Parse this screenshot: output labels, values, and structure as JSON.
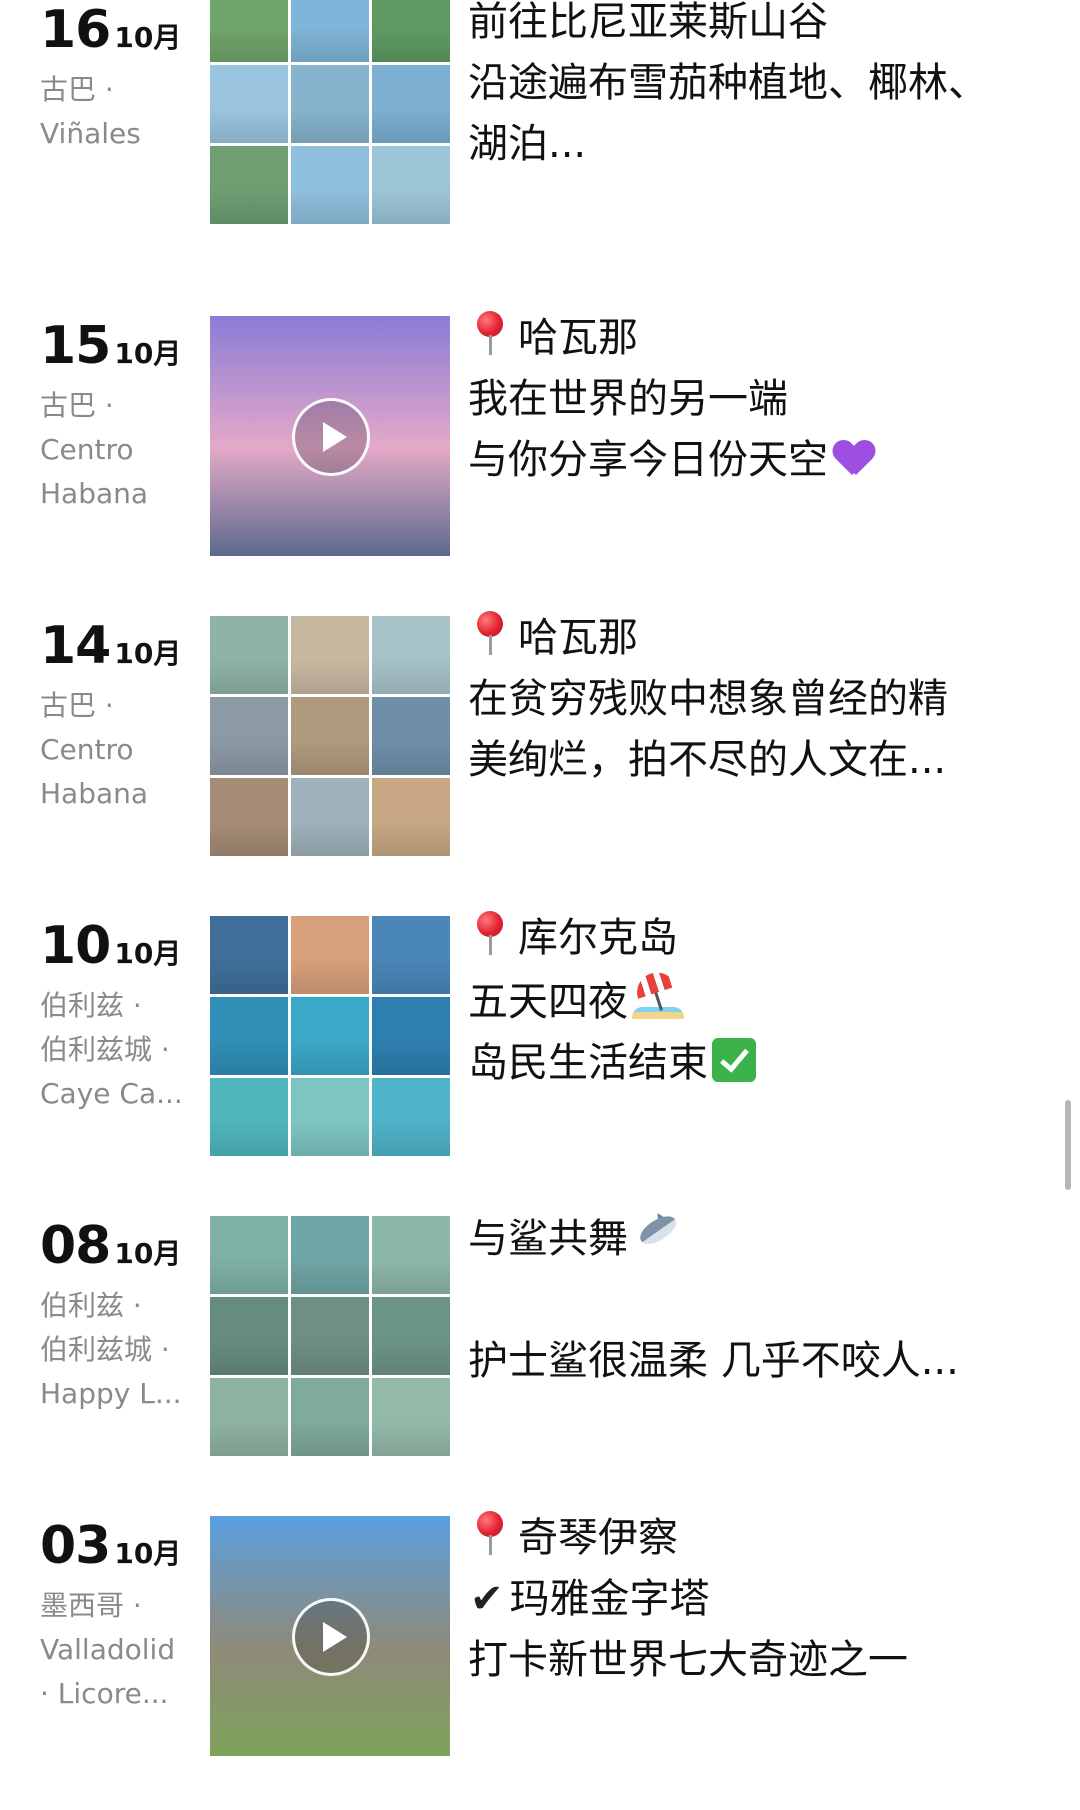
{
  "posts": [
    {
      "day": "16",
      "month": "10月",
      "location": [
        "古巴 ·",
        "Viñales"
      ],
      "media": "grid",
      "caption": [
        {
          "text": "前往比尼亚莱斯山谷"
        },
        {
          "text": "沿途遍布雪茄种植地、椰林、"
        },
        {
          "text": "湖泊..."
        }
      ],
      "colors": [
        "#6fa56a",
        "#7fb5d8",
        "#5f9a63",
        "#9ac4e0",
        "#86b4cc",
        "#7dafd3",
        "#6d9f73",
        "#8fc0de",
        "#9cc5d8"
      ]
    },
    {
      "day": "15",
      "month": "10月",
      "location": [
        "古巴 ·",
        "Centro",
        "Habana"
      ],
      "media": "video",
      "caption": [
        {
          "text": "哈瓦那",
          "pin": true
        },
        {
          "text": "我在世界的另一端"
        },
        {
          "text": "与你分享今日份天空",
          "emoji": "purple-heart"
        }
      ],
      "colors": [
        "#8b7bd8",
        "#e3a9c7",
        "#5c6a8e"
      ]
    },
    {
      "day": "14",
      "month": "10月",
      "location": [
        "古巴 ·",
        "Centro",
        "Habana"
      ],
      "media": "grid",
      "caption": [
        {
          "text": "哈瓦那",
          "pin": true
        },
        {
          "text": "在贫穷残败中想象曾经的精"
        },
        {
          "text": "美绚烂，拍不尽的人文在..."
        }
      ],
      "colors": [
        "#8fb3a8",
        "#c7b8a0",
        "#a7c3c8",
        "#8c9aa6",
        "#b09a7e",
        "#6f8fa8",
        "#a58c76",
        "#9fb1bb",
        "#c8a884"
      ]
    },
    {
      "day": "10",
      "month": "10月",
      "location": [
        "伯利兹 ·",
        "伯利兹城 ·",
        "Caye Ca..."
      ],
      "media": "grid",
      "caption": [
        {
          "text": "库尔克岛",
          "pin": true
        },
        {
          "text": "五天四夜",
          "emoji": "beach"
        },
        {
          "text": "岛民生活结束",
          "emoji": "check"
        }
      ],
      "colors": [
        "#3f6f99",
        "#d7a07a",
        "#4a86b8",
        "#2f8fb7",
        "#3aa8c8",
        "#2d7fb0",
        "#4fb6bd",
        "#7cc5c1",
        "#4fb3c9"
      ]
    },
    {
      "day": "08",
      "month": "10月",
      "location": [
        "伯利兹 ·",
        "伯利兹城 ·",
        "Happy L..."
      ],
      "media": "grid",
      "caption": [
        {
          "text": "与鲨共舞",
          "emoji": "shark"
        },
        {
          "text": ""
        },
        {
          "text": "护士鲨很温柔 几乎不咬人..."
        }
      ],
      "colors": [
        "#7fb1a4",
        "#6fa6a5",
        "#8db8a7",
        "#668c7e",
        "#6f8f83",
        "#6c9485",
        "#8fb3a3",
        "#7faa9d",
        "#93b9a9"
      ]
    },
    {
      "day": "03",
      "month": "10月",
      "location": [
        "墨西哥 ·",
        "Valladolid",
        "· Licore..."
      ],
      "media": "video",
      "caption": [
        {
          "text": "奇琴伊察",
          "pin": true
        },
        {
          "text": "玛雅金字塔",
          "tick": "✔"
        },
        {
          "text": "打卡新世界七大奇迹之一"
        }
      ],
      "colors": [
        "#5aa0e0",
        "#8f8a7a",
        "#7ea35a"
      ]
    }
  ]
}
